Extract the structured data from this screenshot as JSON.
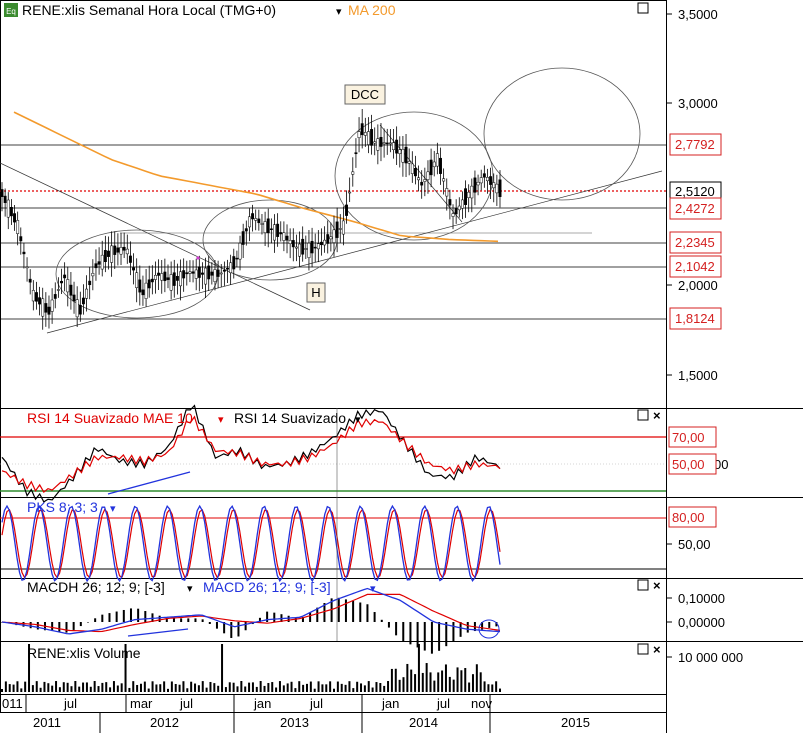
{
  "chart_data": {
    "type": "line",
    "title": "RENE:xlis Semanal Hora Local (TMG+0)",
    "price_panel": {
      "ylim": [
        1.3,
        3.6
      ],
      "y_ticks": [
        "3,5000",
        "3,0000",
        "2,0000",
        "1,5000"
      ],
      "last_price_label": "2,5120",
      "level_labels": [
        "2,7792",
        "2,4272",
        "2,2345",
        "2,1042",
        "1,8124"
      ],
      "legend_ma": "MA 200",
      "annotations": [
        "DCC",
        "H"
      ],
      "series": [
        {
          "name": "RENE:xlis",
          "values": [
            2.5,
            2.33,
            1.95,
            1.85,
            2.05,
            1.85,
            2.1,
            2.18,
            2.2,
            1.95,
            2.06,
            2.02,
            2.07,
            2.06,
            2.06,
            2.12,
            2.38,
            2.32,
            2.28,
            2.2,
            2.2,
            2.25,
            2.33,
            2.86,
            2.78,
            2.78,
            2.7,
            2.55,
            2.7,
            2.38,
            2.5,
            2.6,
            2.52
          ]
        },
        {
          "name": "MA 200",
          "values": [
            2.95,
            2.82,
            2.69,
            2.6,
            2.55,
            2.5,
            2.42,
            2.35,
            2.27,
            2.25,
            2.24
          ]
        }
      ]
    },
    "rsi_panel": {
      "label_a": "RSI 14 Suavizado MAE 10",
      "label_b": "RSI 14 Suavizado",
      "level_labels": [
        "70,00",
        "50,00"
      ],
      "clipped_label": "00",
      "ylim": [
        0,
        100
      ],
      "series": [
        {
          "name": "RSI 14 Suavizado",
          "values": [
            55,
            30,
            22,
            40,
            62,
            52,
            50,
            62,
            95,
            55,
            60,
            48,
            50,
            58,
            70,
            86,
            90,
            65,
            42,
            40,
            55,
            48
          ]
        },
        {
          "name": "RSI 14 Suavizado MAE 10",
          "values": [
            45,
            35,
            30,
            42,
            55,
            55,
            52,
            58,
            85,
            60,
            58,
            50,
            50,
            55,
            65,
            80,
            82,
            65,
            50,
            45,
            50,
            48
          ]
        }
      ]
    },
    "pks_panel": {
      "label": "PKS 8; 3; 3",
      "level_labels": [
        "80,00"
      ],
      "y_ticks": [
        "50,00"
      ],
      "ylim": [
        0,
        100
      ]
    },
    "macd_panel": {
      "label_a": "MACDH 26; 12; 9; [-3]",
      "label_b": "MACD 26; 12; 9; [-3]",
      "y_ticks": [
        "0,10000",
        "0,00000"
      ]
    },
    "volume_panel": {
      "label": "RENE:xlis Volume",
      "y_ticks": [
        "10 000 000"
      ]
    },
    "x_axis": {
      "months": [
        "011",
        "jul",
        "mar",
        "jul",
        "jan",
        "jul",
        "jan",
        "jul",
        "nov"
      ],
      "years": [
        "2011",
        "2012",
        "2013",
        "2014",
        "2015"
      ]
    },
    "colors": {
      "price": "#000000",
      "ma200": "#f39a2c",
      "rsi_signal": "#e00000",
      "pks_fast": "#2233dd",
      "support_green": "#2e8b2e",
      "level_box": "#d42020"
    }
  }
}
